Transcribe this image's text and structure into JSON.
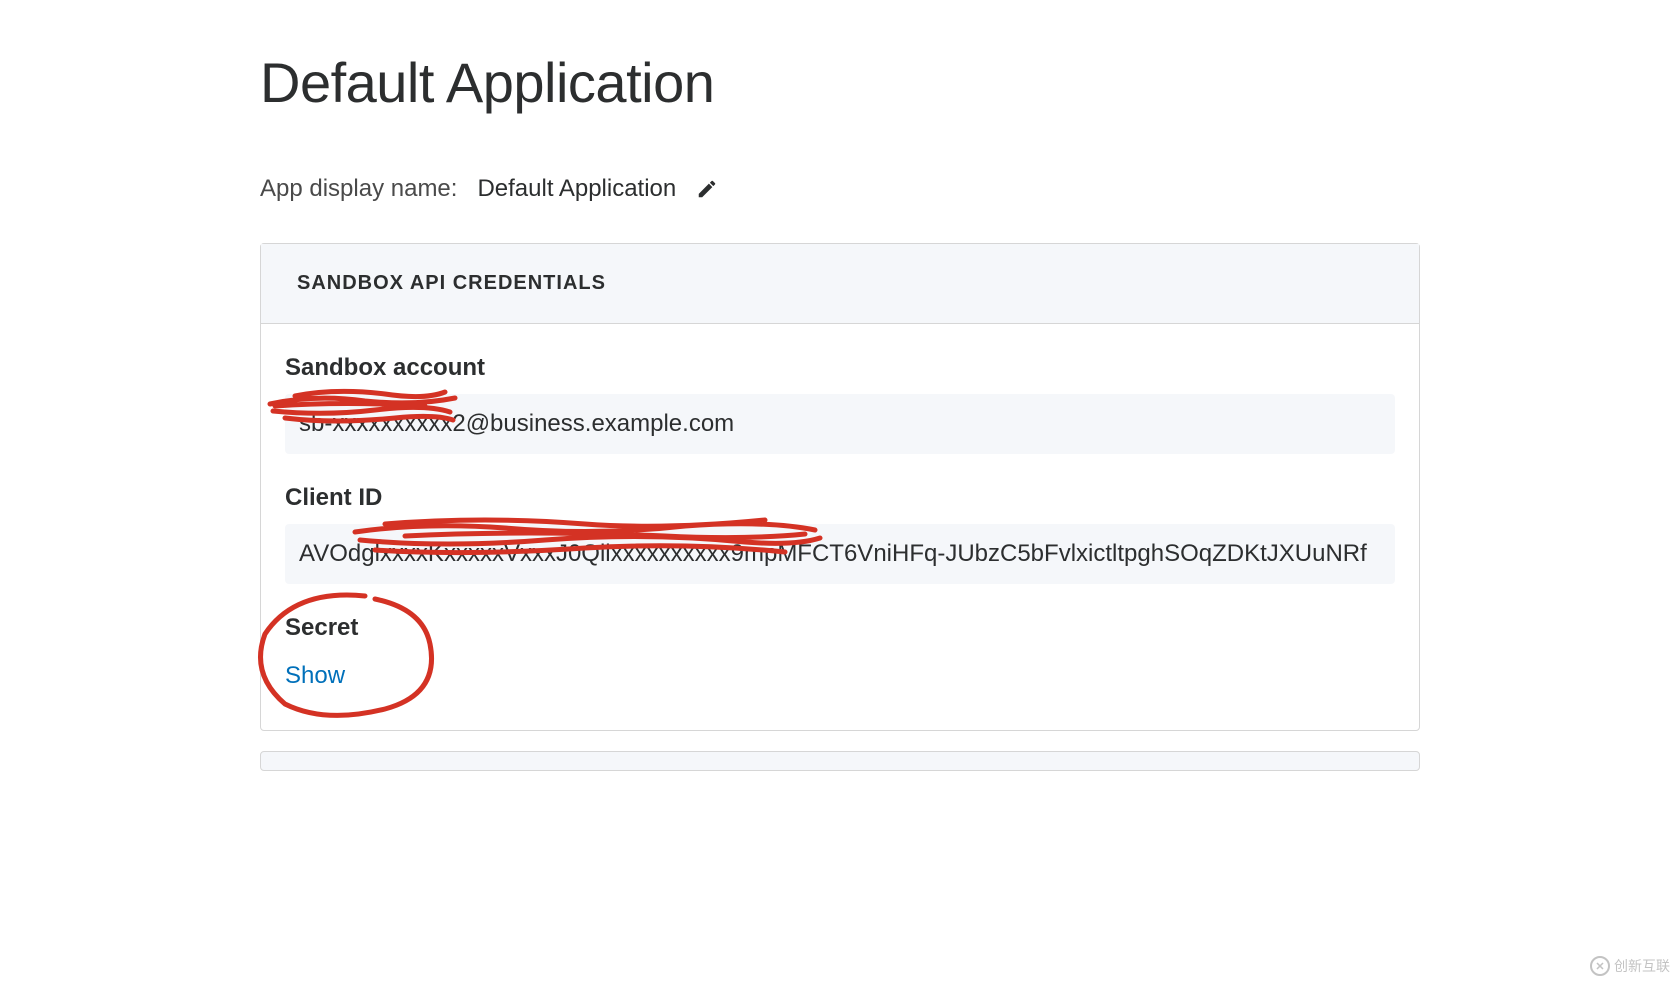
{
  "page_title": "Default Application",
  "display_name": {
    "label": "App display name:",
    "value": "Default Application"
  },
  "credentials_card": {
    "header": "SANDBOX API CREDENTIALS",
    "sandbox_account": {
      "label": "Sandbox account",
      "value": "sb-xxxxxxxxxx2@business.example.com"
    },
    "client_id": {
      "label": "Client ID",
      "value": "AVOdglxxxxKxxxxxVxxxJ0Qllxxxxxxxxxx9mpMFCT6VniHFq-JUbzC5bFvlxictltpghSOqZDKtJXUuNRf"
    },
    "secret": {
      "label": "Secret",
      "show_link": "Show"
    }
  },
  "watermark": "创新互联"
}
